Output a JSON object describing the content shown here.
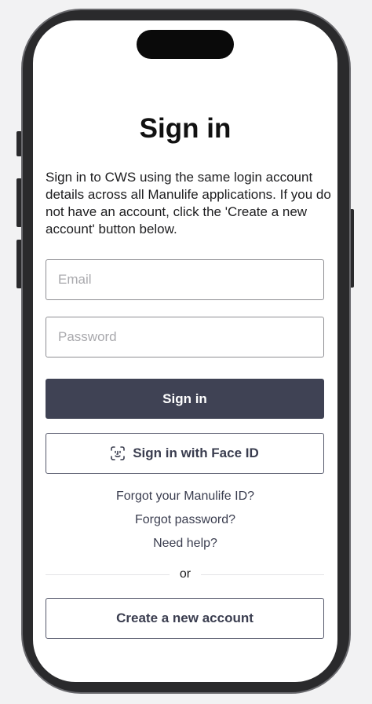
{
  "page": {
    "title": "Sign in",
    "intro": "Sign in to CWS using the same login account details across all Manulife applications. If you do not have an account, click the 'Create a new account' button below."
  },
  "form": {
    "email_placeholder": "Email",
    "password_placeholder": "Password",
    "sign_in_label": "Sign in",
    "face_id_label": "Sign in with Face ID",
    "face_id_icon": "face-id-icon"
  },
  "links": {
    "forgot_id": "Forgot your Manulife ID?",
    "forgot_password": "Forgot password?",
    "need_help": "Need help?"
  },
  "divider": {
    "label": "or"
  },
  "create_account_label": "Create a new account",
  "colors": {
    "primary_button": "#3f4254",
    "text_dark": "#1d1d1f",
    "border": "#8e8e93"
  }
}
